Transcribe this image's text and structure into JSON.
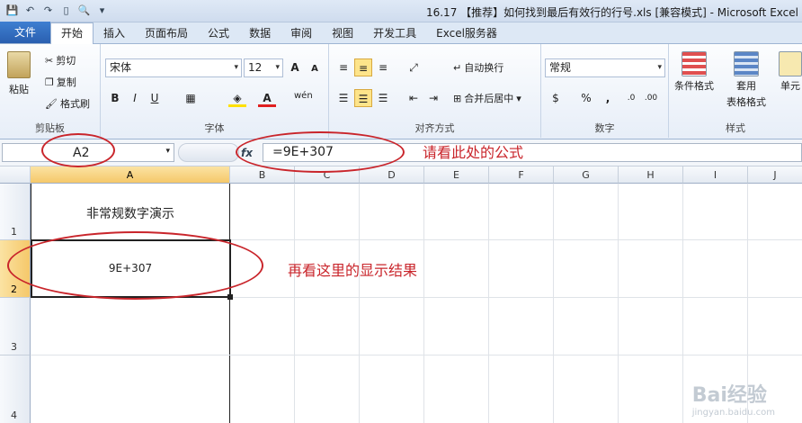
{
  "window": {
    "title": "16.17 【推荐】如何找到最后有效行的行号.xls [兼容模式] - Microsoft Excel"
  },
  "qat": {
    "save": "💾",
    "undo": "↶",
    "redo": "↷",
    "new": "▯",
    "preview": "🔍",
    "more": "▾"
  },
  "tabs": [
    "文件",
    "开始",
    "插入",
    "页面布局",
    "公式",
    "数据",
    "审阅",
    "视图",
    "开发工具",
    "Excel服务器"
  ],
  "ribbon": {
    "clipboard": {
      "paste": "粘贴",
      "cut": "剪切",
      "copy": "复制",
      "format_painter": "格式刷",
      "label": "剪贴板"
    },
    "font": {
      "name": "宋体",
      "size": "12",
      "grow": "A",
      "shrink": "A",
      "bold": "B",
      "italic": "I",
      "underline": "U",
      "label": "字体"
    },
    "alignment": {
      "wrap": "自动换行",
      "merge": "合并后居中",
      "label": "对齐方式"
    },
    "number": {
      "format": "常规",
      "percent": "%",
      "comma": ",",
      "label": "数字"
    },
    "styles": {
      "conditional": "条件格式",
      "table_line1": "套用",
      "table_line2": "表格格式",
      "cell_styles": "单元",
      "label": "样式"
    }
  },
  "formula_bar": {
    "name_box": "A2",
    "fx": "fx",
    "formula": "=9E+307"
  },
  "columns": [
    "A",
    "B",
    "C",
    "D",
    "E",
    "F",
    "G",
    "H",
    "I",
    "J"
  ],
  "rows": [
    "1",
    "2",
    "3",
    "4"
  ],
  "cells": {
    "A1": "非常规数字演示",
    "A2": "9E+307"
  },
  "annotations": {
    "formula_note": "请看此处的公式",
    "result_note": "再看这里的显示结果",
    "color": "#c9252b"
  },
  "watermark": {
    "main": "Bai经验",
    "sub": "jingyan.baidu.com"
  }
}
